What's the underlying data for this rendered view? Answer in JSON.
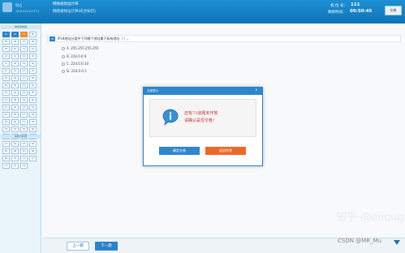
{
  "header": {
    "user_name": "倪达",
    "user_id": "1251414311123",
    "exam_title": "网络规划设计师",
    "exam_subtitle": "网络规划设计师(综合知识)",
    "seat_label": "机  位  号：",
    "seat_value": "111",
    "time_label": "剩余时间：",
    "time_value": "00:50:45",
    "submit_label": "交卷"
  },
  "sidebar": {
    "section1_title": "单项选择题",
    "section2_title": "案例分析题",
    "section1_cells": [
      "01",
      "02",
      "03",
      "04",
      "05",
      "06",
      "07",
      "08",
      "09",
      "10",
      "11",
      "12",
      "13",
      "14",
      "15",
      "16",
      "17",
      "18",
      "19",
      "20",
      "21",
      "22",
      "23",
      "24",
      "25",
      "26",
      "27",
      "28",
      "29",
      "30",
      "31",
      "32",
      "33",
      "34",
      "35",
      "36",
      "37",
      "38",
      "39",
      "40",
      "41",
      "42",
      "43",
      "44",
      "45",
      "46",
      "47",
      "48",
      "49",
      "50",
      "51",
      "52",
      "53",
      "54",
      "55",
      "56",
      "57",
      "58",
      "59",
      "60",
      "61",
      "62",
      "63",
      "64",
      "65",
      "66",
      "67",
      "68",
      "69",
      "70",
      "71",
      "72",
      "73",
      "74",
      "75"
    ],
    "section2_cells": [
      "01",
      "02",
      "03"
    ],
    "done_color": "#2c82c9",
    "current_color": "#f08c2e"
  },
  "question": {
    "number": "01",
    "text": "IPv4地址分类中下列哪个地址属于私有地址（  ）。",
    "options": [
      {
        "label": "A.",
        "text": "255.255.255.255"
      },
      {
        "label": "B.",
        "text": "224.0.0.9"
      },
      {
        "label": "C.",
        "text": "224.0.0.10"
      },
      {
        "label": "D.",
        "text": "224.0.0.1"
      }
    ]
  },
  "footer": {
    "prev_label": "上一题",
    "next_label": "下一题"
  },
  "dialog": {
    "title": "交卷提示",
    "close_icon": "close-icon",
    "message_line1": "还有73道题未作答",
    "message_line2": "请确认是否交卷！",
    "confirm_label": "确定交卷",
    "return_label": "返回作答",
    "confirm_color": "#2f86cd",
    "return_color": "#eb6a2a"
  },
  "watermarks": {
    "zhihu": "知乎 @enough",
    "csdn": "CSDN @MR_Mu"
  },
  "colors": {
    "header_blue": "#1a86cc",
    "primary": "#2c82c9",
    "accent_orange": "#eb6a2a"
  }
}
